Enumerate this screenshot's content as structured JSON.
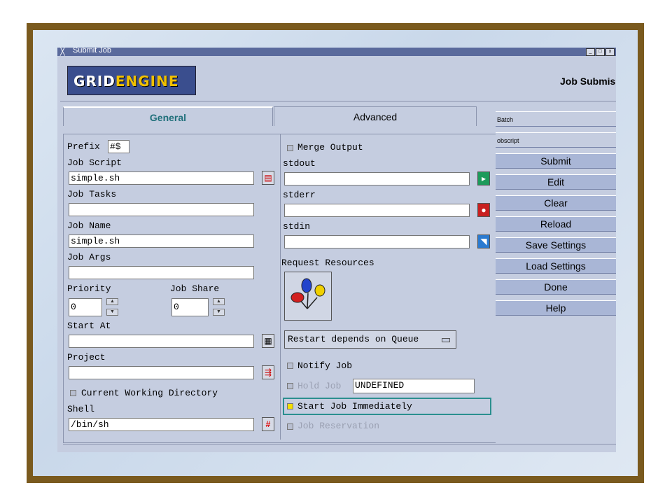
{
  "window": {
    "title": "Submit Job",
    "btn_min": "_",
    "btn_max": "□",
    "btn_close": "x"
  },
  "header": {
    "logo_a": "GRID",
    "logo_b": "ENGINE",
    "title": "Job Submis"
  },
  "tabs": [
    {
      "label": "General"
    },
    {
      "label": "Advanced"
    }
  ],
  "general": {
    "prefix_label": "Prefix",
    "prefix_value": "#$",
    "script_label": "Job Script",
    "script_value": "simple.sh",
    "tasks_label": "Job Tasks",
    "tasks_value": "",
    "name_label": "Job Name",
    "name_value": "simple.sh",
    "args_label": "Job Args",
    "args_value": "",
    "priority_label": "Priority",
    "priority_value": "0",
    "share_label": "Job Share",
    "share_value": "0",
    "start_label": "Start At",
    "start_value": "",
    "project_label": "Project",
    "project_value": "",
    "cwd_label": "Current Working Directory",
    "shell_label": "Shell",
    "shell_value": "/bin/sh"
  },
  "output": {
    "merge_label": "Merge Output",
    "stdout_label": "stdout",
    "stderr_label": "stderr",
    "stdin_label": "stdin",
    "request_label": "Request Resources",
    "restart_label": "Restart depends on Queue",
    "notify_label": "Notify Job",
    "hold_label": "Hold Job",
    "hold_value": "UNDEFINED",
    "start_now_label": "Start Job Immediately",
    "reservation_label": "Job Reservation"
  },
  "side": {
    "field1": "Batch",
    "field2": "obscript",
    "buttons": [
      "Submit",
      "Edit",
      "Clear",
      "Reload",
      "Save Settings",
      "Load Settings",
      "Done",
      "Help"
    ]
  }
}
